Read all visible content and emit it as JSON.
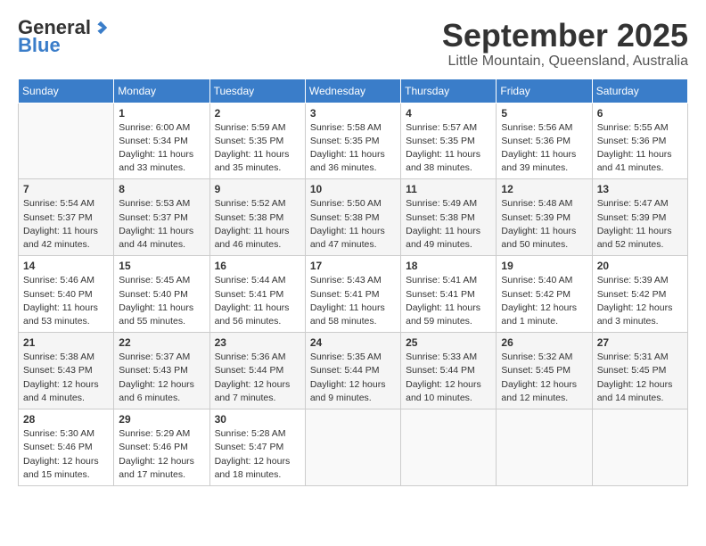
{
  "header": {
    "logo_general": "General",
    "logo_blue": "Blue",
    "month_title": "September 2025",
    "location": "Little Mountain, Queensland, Australia"
  },
  "days_of_week": [
    "Sunday",
    "Monday",
    "Tuesday",
    "Wednesday",
    "Thursday",
    "Friday",
    "Saturday"
  ],
  "weeks": [
    [
      {
        "day": "",
        "info": ""
      },
      {
        "day": "1",
        "info": "Sunrise: 6:00 AM\nSunset: 5:34 PM\nDaylight: 11 hours\nand 33 minutes."
      },
      {
        "day": "2",
        "info": "Sunrise: 5:59 AM\nSunset: 5:35 PM\nDaylight: 11 hours\nand 35 minutes."
      },
      {
        "day": "3",
        "info": "Sunrise: 5:58 AM\nSunset: 5:35 PM\nDaylight: 11 hours\nand 36 minutes."
      },
      {
        "day": "4",
        "info": "Sunrise: 5:57 AM\nSunset: 5:35 PM\nDaylight: 11 hours\nand 38 minutes."
      },
      {
        "day": "5",
        "info": "Sunrise: 5:56 AM\nSunset: 5:36 PM\nDaylight: 11 hours\nand 39 minutes."
      },
      {
        "day": "6",
        "info": "Sunrise: 5:55 AM\nSunset: 5:36 PM\nDaylight: 11 hours\nand 41 minutes."
      }
    ],
    [
      {
        "day": "7",
        "info": "Sunrise: 5:54 AM\nSunset: 5:37 PM\nDaylight: 11 hours\nand 42 minutes."
      },
      {
        "day": "8",
        "info": "Sunrise: 5:53 AM\nSunset: 5:37 PM\nDaylight: 11 hours\nand 44 minutes."
      },
      {
        "day": "9",
        "info": "Sunrise: 5:52 AM\nSunset: 5:38 PM\nDaylight: 11 hours\nand 46 minutes."
      },
      {
        "day": "10",
        "info": "Sunrise: 5:50 AM\nSunset: 5:38 PM\nDaylight: 11 hours\nand 47 minutes."
      },
      {
        "day": "11",
        "info": "Sunrise: 5:49 AM\nSunset: 5:38 PM\nDaylight: 11 hours\nand 49 minutes."
      },
      {
        "day": "12",
        "info": "Sunrise: 5:48 AM\nSunset: 5:39 PM\nDaylight: 11 hours\nand 50 minutes."
      },
      {
        "day": "13",
        "info": "Sunrise: 5:47 AM\nSunset: 5:39 PM\nDaylight: 11 hours\nand 52 minutes."
      }
    ],
    [
      {
        "day": "14",
        "info": "Sunrise: 5:46 AM\nSunset: 5:40 PM\nDaylight: 11 hours\nand 53 minutes."
      },
      {
        "day": "15",
        "info": "Sunrise: 5:45 AM\nSunset: 5:40 PM\nDaylight: 11 hours\nand 55 minutes."
      },
      {
        "day": "16",
        "info": "Sunrise: 5:44 AM\nSunset: 5:41 PM\nDaylight: 11 hours\nand 56 minutes."
      },
      {
        "day": "17",
        "info": "Sunrise: 5:43 AM\nSunset: 5:41 PM\nDaylight: 11 hours\nand 58 minutes."
      },
      {
        "day": "18",
        "info": "Sunrise: 5:41 AM\nSunset: 5:41 PM\nDaylight: 11 hours\nand 59 minutes."
      },
      {
        "day": "19",
        "info": "Sunrise: 5:40 AM\nSunset: 5:42 PM\nDaylight: 12 hours\nand 1 minute."
      },
      {
        "day": "20",
        "info": "Sunrise: 5:39 AM\nSunset: 5:42 PM\nDaylight: 12 hours\nand 3 minutes."
      }
    ],
    [
      {
        "day": "21",
        "info": "Sunrise: 5:38 AM\nSunset: 5:43 PM\nDaylight: 12 hours\nand 4 minutes."
      },
      {
        "day": "22",
        "info": "Sunrise: 5:37 AM\nSunset: 5:43 PM\nDaylight: 12 hours\nand 6 minutes."
      },
      {
        "day": "23",
        "info": "Sunrise: 5:36 AM\nSunset: 5:44 PM\nDaylight: 12 hours\nand 7 minutes."
      },
      {
        "day": "24",
        "info": "Sunrise: 5:35 AM\nSunset: 5:44 PM\nDaylight: 12 hours\nand 9 minutes."
      },
      {
        "day": "25",
        "info": "Sunrise: 5:33 AM\nSunset: 5:44 PM\nDaylight: 12 hours\nand 10 minutes."
      },
      {
        "day": "26",
        "info": "Sunrise: 5:32 AM\nSunset: 5:45 PM\nDaylight: 12 hours\nand 12 minutes."
      },
      {
        "day": "27",
        "info": "Sunrise: 5:31 AM\nSunset: 5:45 PM\nDaylight: 12 hours\nand 14 minutes."
      }
    ],
    [
      {
        "day": "28",
        "info": "Sunrise: 5:30 AM\nSunset: 5:46 PM\nDaylight: 12 hours\nand 15 minutes."
      },
      {
        "day": "29",
        "info": "Sunrise: 5:29 AM\nSunset: 5:46 PM\nDaylight: 12 hours\nand 17 minutes."
      },
      {
        "day": "30",
        "info": "Sunrise: 5:28 AM\nSunset: 5:47 PM\nDaylight: 12 hours\nand 18 minutes."
      },
      {
        "day": "",
        "info": ""
      },
      {
        "day": "",
        "info": ""
      },
      {
        "day": "",
        "info": ""
      },
      {
        "day": "",
        "info": ""
      }
    ]
  ]
}
